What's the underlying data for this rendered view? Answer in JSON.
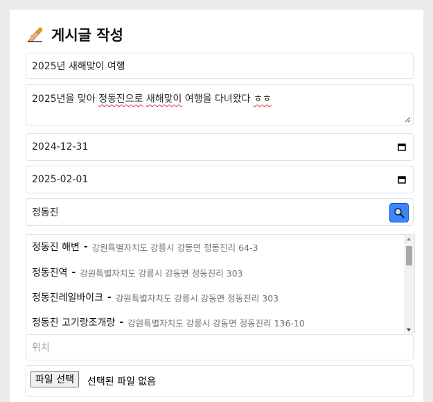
{
  "header": {
    "title": "게시글 작성",
    "icon": "writing-hand-icon"
  },
  "form": {
    "post_title": "2025년 새해맞이 여행",
    "content_parts": [
      "2025년을 맞아 ",
      "정동진으로",
      " ",
      "새해맞이",
      " 여행을 다녀왔다 ",
      "ㅎㅎ"
    ],
    "start_date": "2024-12-31",
    "end_date": "2025-02-01",
    "search_query": "정동진",
    "location_placeholder": "위치",
    "file_button": "파일 선택",
    "file_status": "선택된 파일 없음"
  },
  "results": [
    {
      "name": "정동진 해변",
      "address": "강원특별자치도 강릉시 강동면 정동진리 64-3"
    },
    {
      "name": "정동진역",
      "address": "강원특별자치도 강릉시 강동면 정동진리 303"
    },
    {
      "name": "정동진레일바이크",
      "address": "강원특별자치도 강릉시 강동면 정동진리 303"
    },
    {
      "name": "정동진 고기랑조개랑",
      "address": "강원특별자치도 강릉시 강동면 정동진리 136-10"
    }
  ],
  "separator": "-",
  "colors": {
    "search_button": "#3a86ff",
    "spellcheck": "#e03131"
  }
}
